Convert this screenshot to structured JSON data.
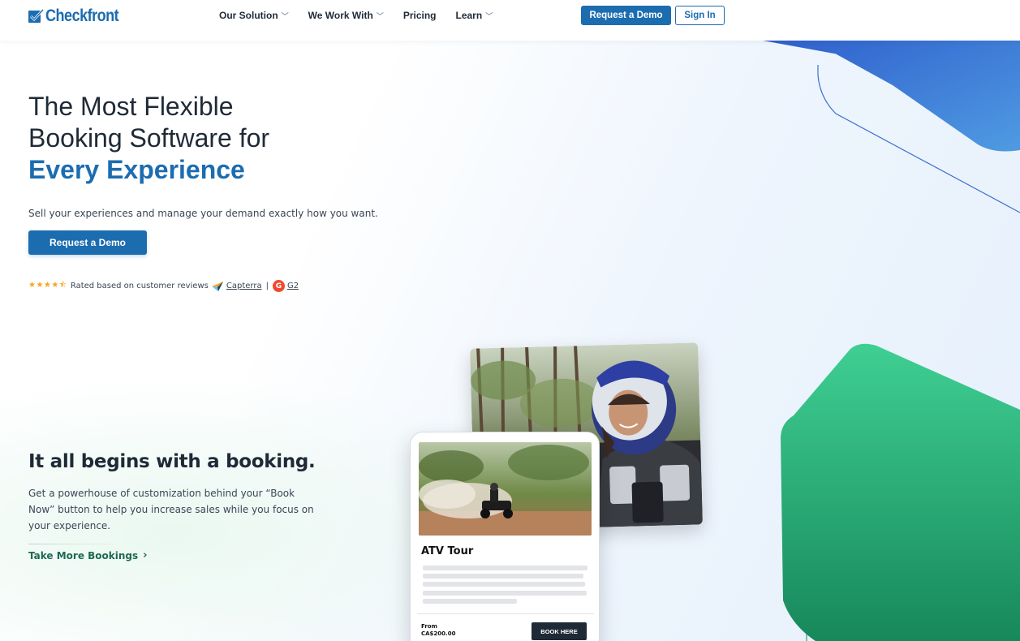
{
  "brand": {
    "name": "Checkfront",
    "color": "#1c6cb0"
  },
  "nav": {
    "items": [
      {
        "label": "Our Solution",
        "dropdown": true
      },
      {
        "label": "We Work With",
        "dropdown": true
      },
      {
        "label": "Pricing",
        "dropdown": false
      },
      {
        "label": "Learn",
        "dropdown": true
      }
    ],
    "demo_label": "Request a Demo",
    "signin_label": "Sign In"
  },
  "hero": {
    "title_line1": "The Most Flexible",
    "title_line2": "Booking Software for",
    "title_highlight": "Every Experience",
    "subtitle": "Sell your experiences and manage your demand exactly how you want.",
    "cta_label": "Request a Demo",
    "rating": {
      "stars": 4.5,
      "text": "Rated based on customer reviews",
      "capterra": "Capterra",
      "separator": "|",
      "g2": "G2"
    }
  },
  "booking_section": {
    "title": "It all begins with a booking.",
    "body": "Get a powerhouse of customization behind your “Book Now” button to help you increase sales while you focus on your experience.",
    "link_label": "Take More Bookings",
    "link_arrow": "›"
  },
  "phone_card": {
    "title": "ATV Tour",
    "from_label": "From",
    "price": "CA$200.00",
    "button_label": "BOOK HERE"
  },
  "colors": {
    "primary": "#1c6cb0",
    "green": "#1d8a5e",
    "star": "#f5a623",
    "dark": "#1f2a37"
  }
}
